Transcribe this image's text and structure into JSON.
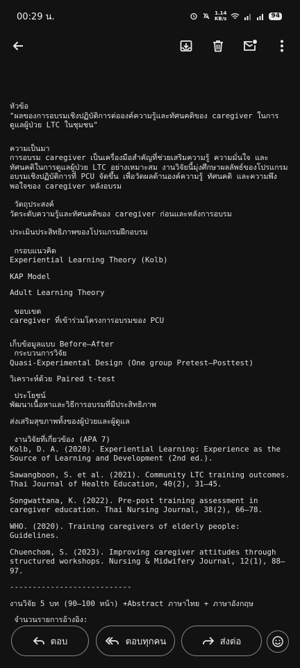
{
  "status_bar": {
    "time": "00:29 น.",
    "net_speed": "1.14",
    "net_unit": "KB/s",
    "battery": "94"
  },
  "toolbar": {
    "back_icon": "arrow-left-icon",
    "archive_icon": "archive-icon",
    "delete_icon": "trash-icon",
    "unread_icon": "mail-unread-icon",
    "more_icon": "more-vert-icon"
  },
  "body": {
    "topic_label": "หัวข้อ",
    "topic_text": "\"ผลของการอบรมเชิงปฏิบัติการต่อองค์ความรู้และทัศนคติของ caregiver ในการดูแลผู้ป่วย LTC ในชุมชน\"",
    "background_label": "ความเป็นมา",
    "background_text": "การอบรม caregiver เป็นเครื่องมือสำคัญที่ช่วยเสริมความรู้ ความมั่นใจ และทัศนคติในการดูแลผู้ป่วย LTC อย่างเหมาะสม งานวิจัยนี้มุ่งศึกษาผลลัพธ์ของโปรแกรมอบรมเชิงปฏิบัติการที่ PCU จัดขึ้น เพื่อวัดผลด้านองค์ความรู้ ทัศนคติ และความพึงพอใจของ caregiver หลังอบรม",
    "objective_label": " วัตถุประสงค์",
    "objective_1": "วัดระดับความรู้และทัศนคติของ caregiver ก่อนและหลังการอบรม",
    "objective_2": "ประเมินประสิทธิภาพของโปรแกรมฝึกอบรม",
    "framework_label": " กรอบแนวคิด",
    "framework_1": "Experiential Learning Theory (Kolb)",
    "framework_2": "KAP Model",
    "framework_3": "Adult Learning Theory",
    "scope_label": " ขอบเขต",
    "scope_text": "caregiver ที่เข้าร่วมโครงการอบรมของ PCU",
    "data_collection": "เก็บข้อมูลแบบ Before–After",
    "method_label": " กระบวนการวิจัย",
    "method_text": "Quasi-Experimental Design (One group Pretest–Posttest)",
    "analysis_text": "วิเคราะห์ด้วย Paired t-test",
    "benefit_label": " ประโยชน์",
    "benefit_1": "พัฒนาเนื้อหาและวิธีการอบรมที่มีประสิทธิภาพ",
    "benefit_2": "ส่งเสริมสุขภาพทั้งของผู้ป่วยและผู้ดูแล",
    "refs_label": " งานวิจัยที่เกี่ยวข้อง (APA 7)",
    "references": [
      "Kolb, D. A. (2020). Experiential Learning: Experience as the Source of Learning and Development (2nd ed.).",
      "Sawangboon, S. et al. (2021). Community LTC training outcomes. Thai Journal of Health Education, 40(2), 31–45.",
      "Songwattana, K. (2022). Pre-post training assessment in caregiver education. Thai Nursing Journal, 38(2), 66–78.",
      "WHO. (2020). Training caregivers of elderly people: Guidelines.",
      "Chuenchom, S. (2023). Improving caregiver attitudes through structured workshops. Nursing & Midwifery Journal, 12(1), 88–97."
    ],
    "divider": "---------------------------",
    "chapters_text": "งานวิจัย 5 บท (90–100 หน้า) +Abstract ภาษาไทย + ภาษาอังกฤษ",
    "ref_count_label": " จำนวนรายการอ้างอิง:"
  },
  "actions": {
    "reply": "ตอบ",
    "reply_all": "ตอบทุกคน",
    "forward": "ส่งต่อ",
    "emoji_icon": "emoji-react-icon"
  }
}
